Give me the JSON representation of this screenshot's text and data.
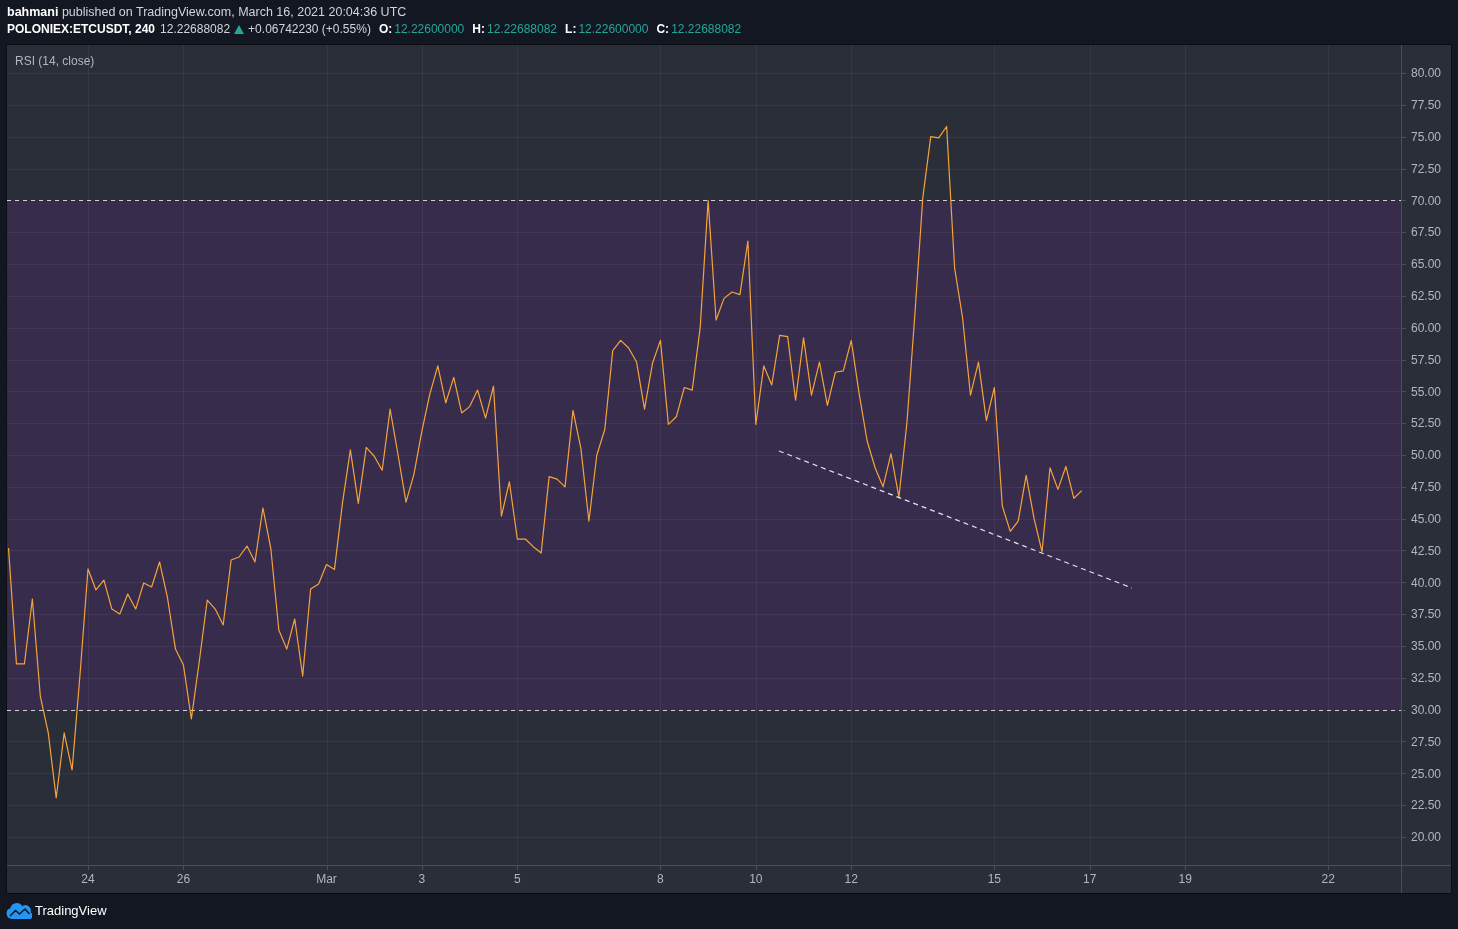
{
  "header": {
    "text": "**bahmani** published on TradingView.com, March 16, 2021 20:04:36 UTC"
  },
  "symbol_bar": {
    "symbol": "POLONIEX:ETCUSDT, 240",
    "price": "12.22688082",
    "rising": true,
    "change": "+0.06742230 (+0.55%)",
    "ohlc": [
      {
        "label": "O:",
        "value": "12.22600000"
      },
      {
        "label": "H:",
        "value": "12.22688082"
      },
      {
        "label": "L:",
        "value": "12.22600000"
      },
      {
        "label": "C:",
        "value": "12.22688082"
      }
    ]
  },
  "chart": {
    "chart_data": {
      "type": "line",
      "categories": [
        null,
        null,
        null,
        null,
        null,
        null,
        null,
        null,
        null,
        null,
        "24",
        null,
        null,
        null,
        null,
        null,
        null,
        null,
        null,
        null,
        null,
        null,
        "26",
        null,
        null,
        null,
        null,
        null,
        null,
        null,
        null,
        null,
        null,
        null,
        null,
        null,
        null,
        null,
        null,
        null,
        "Mar",
        null,
        null,
        null,
        null,
        null,
        null,
        null,
        null,
        null,
        null,
        null,
        "3",
        null,
        null,
        null,
        null,
        null,
        null,
        null,
        null,
        null,
        null,
        null,
        "5",
        null,
        null,
        null,
        null,
        null,
        null,
        null,
        null,
        null,
        null,
        null,
        null,
        null,
        null,
        null,
        null,
        null,
        "8",
        null,
        null,
        null,
        null,
        null,
        null,
        null,
        null,
        null,
        null,
        null,
        "10",
        null,
        null,
        null,
        null,
        null,
        null,
        null,
        null,
        null,
        null,
        null,
        "12",
        null,
        null,
        null,
        null,
        null,
        null,
        null,
        null,
        null,
        null,
        null,
        null,
        null,
        null,
        null,
        null,
        null,
        "15",
        null,
        null,
        null,
        null,
        null,
        null,
        null,
        null,
        null,
        null,
        null,
        "17",
        null,
        null,
        null,
        null,
        null,
        null,
        null,
        null,
        null,
        null,
        null,
        "19",
        null,
        null,
        null,
        null,
        null,
        null,
        null,
        null,
        null,
        null,
        null,
        null,
        null,
        null,
        null,
        null,
        null,
        "22",
        null,
        null,
        null,
        null,
        null,
        null,
        null,
        null,
        null
      ],
      "series": [
        {
          "name": "RSI (14, close)",
          "color": "#f5a33a",
          "values": [
            42.7,
            33.59,
            33.59,
            38.69,
            31.07,
            28.17,
            23.06,
            28.17,
            25.26,
            32.8,
            41.05,
            39.4,
            40.18,
            37.9,
            37.51,
            39.08,
            37.9,
            39.95,
            39.63,
            41.6,
            38.77,
            34.76,
            33.51,
            29.27,
            33.82,
            38.61,
            37.9,
            36.65,
            41.75,
            41.99,
            42.85,
            41.6,
            45.84,
            42.62,
            36.26,
            34.76,
            37.12,
            32.64,
            39.48,
            39.87,
            41.4,
            41.0,
            46.2,
            50.4,
            46.2,
            50.6,
            49.9,
            48.8,
            53.6,
            50.0,
            46.3,
            48.5,
            51.9,
            54.8,
            57.0,
            54.1,
            56.1,
            53.3,
            53.8,
            55.1,
            52.9,
            55.4,
            45.2,
            47.9,
            43.4,
            43.4,
            42.8,
            42.3,
            48.3,
            48.1,
            47.5,
            53.5,
            50.5,
            44.8,
            50.0,
            52.0,
            58.2,
            59.0,
            58.4,
            57.3,
            53.6,
            57.2,
            59.0,
            52.4,
            53.0,
            55.3,
            55.1,
            60.0,
            70.0,
            60.6,
            62.3,
            62.8,
            62.6,
            66.8,
            52.4,
            57.0,
            55.5,
            59.4,
            59.3,
            54.3,
            59.2,
            54.7,
            57.3,
            53.9,
            56.5,
            56.6,
            59.0,
            54.8,
            51.1,
            49.0,
            47.5,
            50.1,
            46.7,
            52.5,
            61.0,
            70.2,
            75.0,
            74.9,
            75.8,
            64.7,
            60.8,
            54.7,
            57.3,
            52.7,
            55.3,
            46.0,
            44.0,
            44.8,
            48.4,
            45.0,
            42.4,
            49.0,
            47.3,
            49.1,
            46.6,
            47.2,
            null,
            null,
            null,
            null,
            null,
            null,
            null,
            null,
            null,
            null,
            null,
            null,
            null,
            null,
            null,
            null,
            null,
            null,
            null,
            null,
            null,
            null,
            null,
            null,
            null,
            null,
            null,
            null,
            null,
            null,
            null,
            null,
            null,
            null,
            null,
            null,
            null,
            null,
            null,
            null
          ]
        }
      ],
      "ylim": [
        17.8,
        82.2
      ],
      "yticks": [
        {
          "value": 80,
          "label": "80.00"
        },
        {
          "value": 77.5,
          "label": "77.50"
        },
        {
          "value": 75,
          "label": "75.00"
        },
        {
          "value": 72.5,
          "label": "72.50"
        },
        {
          "value": 70,
          "label": "70.00"
        },
        {
          "value": 67.5,
          "label": "67.50"
        },
        {
          "value": 65,
          "label": "65.00"
        },
        {
          "value": 62.5,
          "label": "62.50"
        },
        {
          "value": 60,
          "label": "60.00"
        },
        {
          "value": 57.5,
          "label": "57.50"
        },
        {
          "value": 55,
          "label": "55.00"
        },
        {
          "value": 52.5,
          "label": "52.50"
        },
        {
          "value": 50,
          "label": "50.00"
        },
        {
          "value": 47.5,
          "label": "47.50"
        },
        {
          "value": 45,
          "label": "45.00"
        },
        {
          "value": 42.5,
          "label": "42.50"
        },
        {
          "value": 40,
          "label": "40.00"
        },
        {
          "value": 37.5,
          "label": "37.50"
        },
        {
          "value": 35,
          "label": "35.00"
        },
        {
          "value": 32.5,
          "label": "32.50"
        },
        {
          "value": 30,
          "label": "30.00"
        },
        {
          "value": 27.5,
          "label": "27.50"
        },
        {
          "value": 25,
          "label": "25.00"
        },
        {
          "value": 22.5,
          "label": "22.50"
        },
        {
          "value": 20,
          "label": "20.00"
        }
      ],
      "grid": true,
      "bands": [
        {
          "axis": "y",
          "from": 30,
          "to": 70
        }
      ]
    }
  },
  "footer": {
    "brand": "TradingView"
  }
}
